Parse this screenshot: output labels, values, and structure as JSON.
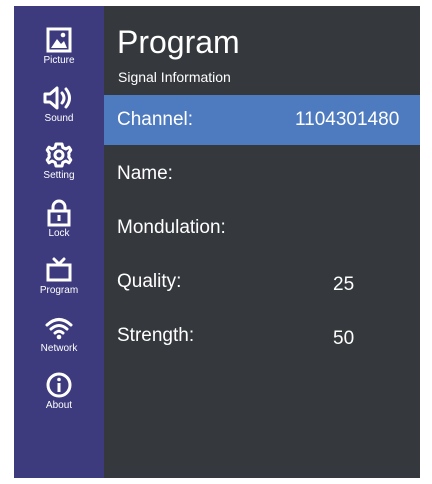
{
  "sidebar": {
    "items": [
      {
        "label": "Picture",
        "icon": "picture-icon"
      },
      {
        "label": "Sound",
        "icon": "speaker-icon"
      },
      {
        "label": "Setting",
        "icon": "gear-icon"
      },
      {
        "label": "Lock",
        "icon": "lock-icon"
      },
      {
        "label": "Program",
        "icon": "tv-icon"
      },
      {
        "label": "Network",
        "icon": "wifi-icon"
      },
      {
        "label": "About",
        "icon": "info-icon"
      }
    ]
  },
  "main": {
    "title": "Program",
    "subtitle": "Signal Information",
    "rows": [
      {
        "label": "Channel:",
        "value": "1104301480",
        "selected": true
      },
      {
        "label": "Name:",
        "value": ""
      },
      {
        "label": "Mondulation:",
        "value": ""
      },
      {
        "label": "Quality:",
        "value": "25"
      },
      {
        "label": "Strength:",
        "value": "50"
      }
    ]
  },
  "colors": {
    "sidebar_bg": "#3d3b7e",
    "panel_bg": "#35393e",
    "selected_row": "#4e7bbf",
    "text": "#ffffff"
  }
}
